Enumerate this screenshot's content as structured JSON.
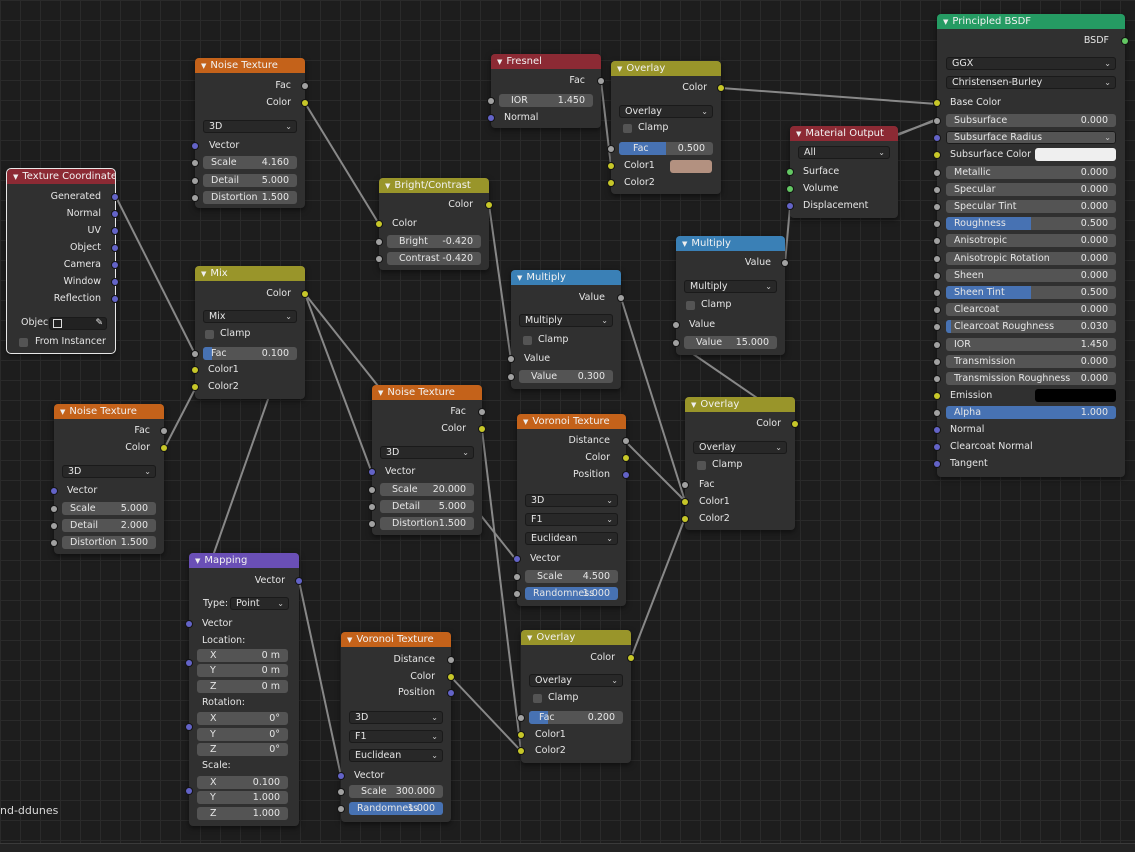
{
  "editor": {
    "material_name": "nd-ddunes"
  },
  "colors": {
    "header_input": "#8c2a34",
    "header_texture": "#c4621a",
    "header_converter": "#3a80b6",
    "header_color": "#99952a",
    "header_vector": "#6a4fb6",
    "header_shader": "#259b63",
    "socket_color": "#c7c729",
    "socket_vector": "#6363c7",
    "socket_float": "#a1a1a1",
    "socket_shader": "#63c763"
  },
  "texcoord": {
    "title": "Texture Coordinate",
    "outputs": [
      "Generated",
      "Normal",
      "UV",
      "Object",
      "Camera",
      "Window",
      "Reflection"
    ],
    "object_label": "Objec",
    "instancer_label": "From Instancer"
  },
  "noise1": {
    "title": "Noise Texture",
    "out_fac": "Fac",
    "out_color": "Color",
    "dimension": "3D",
    "in_vector": "Vector",
    "scale_label": "Scale",
    "scale_value": "4.160",
    "detail_label": "Detail",
    "detail_value": "5.000",
    "distortion_label": "Distortion",
    "distortion_value": "1.500"
  },
  "noise2": {
    "title": "Noise Texture",
    "out_fac": "Fac",
    "out_color": "Color",
    "dimension": "3D",
    "in_vector": "Vector",
    "scale_label": "Scale",
    "scale_value": "5.000",
    "detail_label": "Detail",
    "detail_value": "2.000",
    "distortion_label": "Distortion",
    "distortion_value": "1.500"
  },
  "noise3": {
    "title": "Noise Texture",
    "out_fac": "Fac",
    "out_color": "Color",
    "dimension": "3D",
    "in_vector": "Vector",
    "scale_label": "Scale",
    "scale_value": "20.000",
    "detail_label": "Detail",
    "detail_value": "5.000",
    "distortion_label": "Distortion",
    "distortion_value": "1.500"
  },
  "mix1": {
    "title": "Mix",
    "out_color": "Color",
    "blend": "Mix",
    "clamp_label": "Clamp",
    "fac_label": "Fac",
    "fac_value": "0.100",
    "fac_fraction": 0.1,
    "in_color1": "Color1",
    "in_color2": "Color2"
  },
  "bright": {
    "title": "Bright/Contrast",
    "out_color": "Color",
    "in_color": "Color",
    "bright_label": "Bright",
    "bright_value": "-0.420",
    "contrast_label": "Contrast",
    "contrast_value": "-0.420"
  },
  "fresnel": {
    "title": "Fresnel",
    "out_fac": "Fac",
    "ior_label": "IOR",
    "ior_value": "1.450",
    "in_normal": "Normal"
  },
  "overlay1": {
    "title": "Overlay",
    "out_color": "Color",
    "blend": "Overlay",
    "clamp_label": "Clamp",
    "fac_label": "Fac",
    "fac_value": "0.500",
    "fac_fraction": 0.5,
    "in_color1": "Color1",
    "in_color2": "Color2",
    "color1_swatch": "#b39180"
  },
  "multiply1": {
    "title": "Multiply",
    "out_value": "Value",
    "op": "Multiply",
    "clamp_label": "Clamp",
    "in_value": "Value",
    "value_label": "Value",
    "value_value": "0.300"
  },
  "voronoi1": {
    "title": "Voronoi Texture",
    "out_distance": "Distance",
    "out_color": "Color",
    "out_position": "Position",
    "dimension": "3D",
    "feature": "F1",
    "metric": "Euclidean",
    "in_vector": "Vector",
    "scale_label": "Scale",
    "scale_value": "4.500",
    "random_label": "Randomness",
    "random_value": "1.000"
  },
  "voronoi2": {
    "title": "Voronoi Texture",
    "out_distance": "Distance",
    "out_color": "Color",
    "out_position": "Position",
    "dimension": "3D",
    "feature": "F1",
    "metric": "Euclidean",
    "in_vector": "Vector",
    "scale_label": "Scale",
    "scale_value": "300.000",
    "random_label": "Randomness",
    "random_value": "1.000"
  },
  "matout": {
    "title": "Material Output",
    "target": "All",
    "in_surface": "Surface",
    "in_volume": "Volume",
    "in_displacement": "Displacement"
  },
  "multiply2": {
    "title": "Multiply",
    "out_value": "Value",
    "op": "Multiply",
    "clamp_label": "Clamp",
    "in_value": "Value",
    "value_label": "Value",
    "value_value": "15.000"
  },
  "overlay2": {
    "title": "Overlay",
    "out_color": "Color",
    "blend": "Overlay",
    "clamp_label": "Clamp",
    "in_fac": "Fac",
    "in_color1": "Color1",
    "in_color2": "Color2"
  },
  "overlay3": {
    "title": "Overlay",
    "out_color": "Color",
    "blend": "Overlay",
    "clamp_label": "Clamp",
    "fac_label": "Fac",
    "fac_value": "0.200",
    "fac_fraction": 0.2,
    "in_color1": "Color1",
    "in_color2": "Color2"
  },
  "mapping": {
    "title": "Mapping",
    "out_vector": "Vector",
    "type_label": "Type:",
    "type_value": "Point",
    "in_vector": "Vector",
    "location_label": "Location:",
    "loc_x": "0 m",
    "loc_y": "0 m",
    "loc_z": "0 m",
    "rotation_label": "Rotation:",
    "rot_x": "0°",
    "rot_y": "0°",
    "rot_z": "0°",
    "scale_label": "Scale:",
    "scale_x": "0.100",
    "scale_y": "1.000",
    "scale_z": "1.000",
    "x": "X",
    "y": "Y",
    "z": "Z"
  },
  "bsdf": {
    "title": "Principled BSDF",
    "out_bsdf": "BSDF",
    "distribution": "GGX",
    "subsurface_method": "Christensen-Burley",
    "base_color": "Base Color",
    "fields": [
      {
        "label": "Subsurface",
        "value": "0.000",
        "fraction": 0
      },
      {
        "label": "Subsurface Radius",
        "value": "",
        "fraction": 0
      },
      {
        "label": "Subsurface Color",
        "value": "",
        "fraction": 0
      },
      {
        "label": "Metallic",
        "value": "0.000",
        "fraction": 0
      },
      {
        "label": "Specular",
        "value": "0.000",
        "fraction": 0
      },
      {
        "label": "Specular Tint",
        "value": "0.000",
        "fraction": 0
      },
      {
        "label": "Roughness",
        "value": "0.500",
        "fraction": 0.5
      },
      {
        "label": "Anisotropic",
        "value": "0.000",
        "fraction": 0
      },
      {
        "label": "Anisotropic Rotation",
        "value": "0.000",
        "fraction": 0
      },
      {
        "label": "Sheen",
        "value": "0.000",
        "fraction": 0
      },
      {
        "label": "Sheen Tint",
        "value": "0.500",
        "fraction": 0.5
      },
      {
        "label": "Clearcoat",
        "value": "0.000",
        "fraction": 0
      },
      {
        "label": "Clearcoat Roughness",
        "value": "0.030",
        "fraction": 0.03
      },
      {
        "label": "IOR",
        "value": "1.450",
        "fraction": 0
      },
      {
        "label": "Transmission",
        "value": "0.000",
        "fraction": 0
      },
      {
        "label": "Transmission Roughness",
        "value": "0.000",
        "fraction": 0
      },
      {
        "label": "Emission",
        "value": "",
        "fraction": 0
      },
      {
        "label": "Alpha",
        "value": "1.000",
        "fraction": 1
      }
    ],
    "in_normal": "Normal",
    "in_clearcoat_normal": "Clearcoat Normal",
    "in_tangent": "Tangent",
    "subsurface_color_swatch": "#efefef",
    "emission_swatch": "#000000"
  }
}
